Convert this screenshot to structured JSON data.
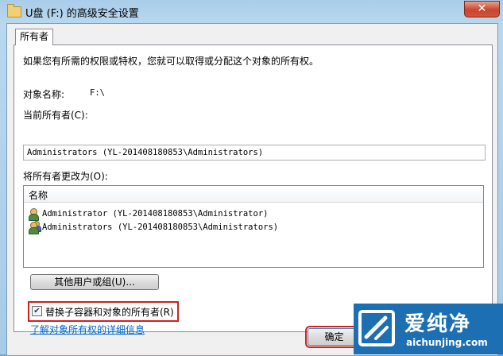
{
  "window": {
    "title": "U盘 (F:) 的高级安全设置",
    "close_glyph": "✕",
    "folder_icon": "folder-icon"
  },
  "tab": {
    "label": "所有者"
  },
  "intro": "如果您有所需的权限或特权，您就可以取得或分配这个对象的所有权。",
  "object": {
    "label": "对象名称:",
    "value": "F:\\"
  },
  "current_owner": {
    "label": "当前所有者(C):",
    "value": "Administrators (YL-201408180853\\Administrators)"
  },
  "change_owner": {
    "label": "将所有者更改为(O):",
    "column_header": "名称",
    "items": [
      {
        "icon": "user-icon",
        "name": "Administrator (YL-201408180853\\Administrator)"
      },
      {
        "icon": "group-icon",
        "name": "Administrators (YL-201408180853\\Administrators)"
      }
    ]
  },
  "other_users_button": "其他用户或组(U)...",
  "replace_owner": {
    "checked": true,
    "check_glyph": "✔",
    "label": "替换子容器和对象的所有者(R)"
  },
  "learn_link": "了解对象所有权的详细信息",
  "ok_button": "确定",
  "watermark": {
    "text": "爱纯净",
    "url": "aichunjing.com"
  }
}
